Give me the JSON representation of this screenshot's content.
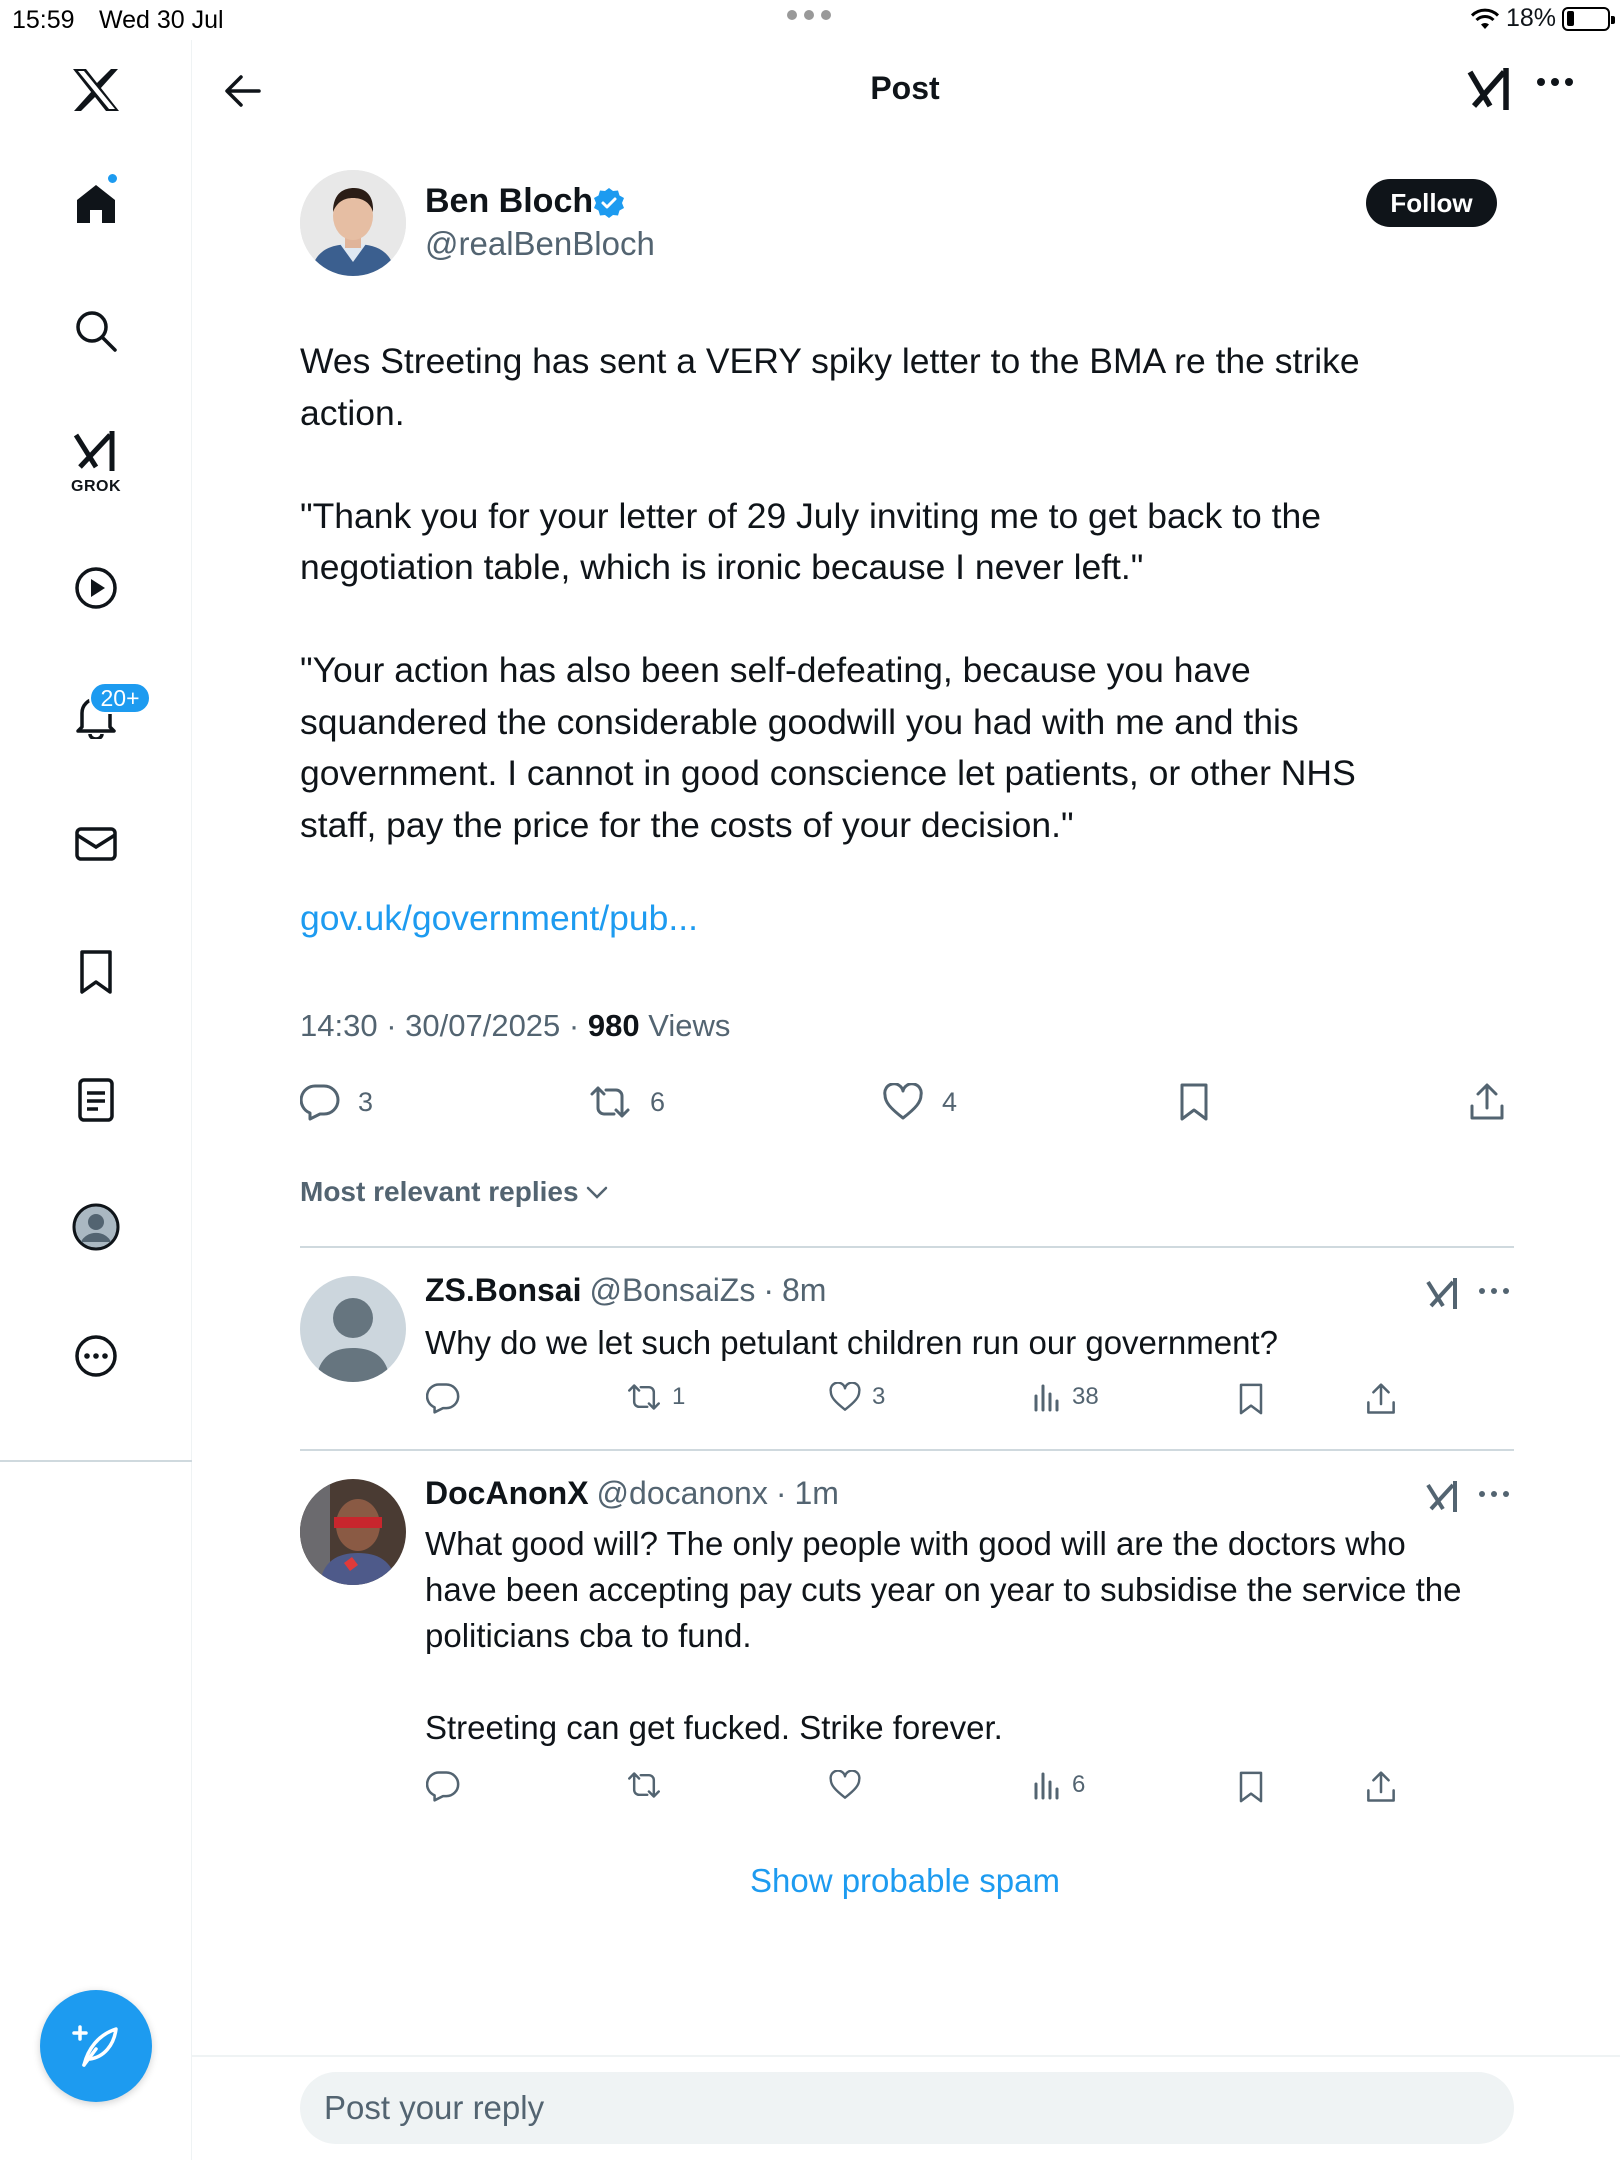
{
  "status_bar": {
    "time": "15:59",
    "date": "Wed 30 Jul",
    "battery": "18%",
    "battery_level": 0.18
  },
  "sidebar": {
    "grok_label": "GROK",
    "notification_badge": "20+",
    "icons": [
      "x-logo-icon",
      "home-icon",
      "search-icon",
      "grok-icon",
      "video-icon",
      "bell-icon",
      "mail-icon",
      "bookmark-icon",
      "lists-icon",
      "profile-icon",
      "more-icon"
    ]
  },
  "header": {
    "title": "Post"
  },
  "post": {
    "author_name": "Ben Bloch",
    "author_handle": "@realBenBloch",
    "follow_label": "Follow",
    "paragraphs": [
      "Wes Streeting has sent a VERY spiky letter to the BMA re the strike\naction.",
      "\"Thank you for your letter of 29 July inviting me to get back to the\nnegotiation table, which is ironic because I never left.\"",
      "\"Your action has also been self-defeating, because you have\nsquandered the considerable goodwill you had with me and this\ngovernment. I cannot in good conscience let patients, or other NHS\nstaff, pay the price for the costs of your decision.\""
    ],
    "link": "gov.uk/government/pub...",
    "time": "14:30",
    "date": "30/07/2025",
    "views_count": "980",
    "views_label": "Views",
    "replies": "3",
    "reposts": "6",
    "likes": "4"
  },
  "replies_section": {
    "sort_label": "Most relevant replies"
  },
  "replies": [
    {
      "name": "ZS.Bonsai",
      "handle": "@BonsaiZs",
      "time": "8m",
      "text": "Why do we let such petulant children run our government?",
      "replies": "",
      "reposts": "1",
      "likes": "3",
      "views": "38"
    },
    {
      "name": "DocAnonX",
      "handle": "@docanonx",
      "time": "1m",
      "text": "What good will? The only people with good will are the doctors who\nhave been accepting pay cuts year on year to subsidise the service the\npoliticians cba to fund.\n\nStreeting can get fucked. Strike forever.",
      "replies": "",
      "reposts": "",
      "likes": "",
      "views": "6"
    }
  ],
  "show_spam": "Show probable spam",
  "composer": {
    "placeholder": "Post your reply"
  },
  "colors": {
    "accent": "#1d9bf0",
    "text": "#0f1419",
    "muted": "#536471",
    "border": "#cfd9de"
  }
}
